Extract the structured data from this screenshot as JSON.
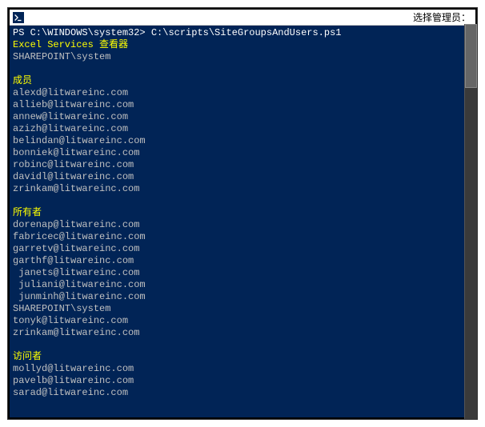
{
  "titlebar": {
    "icon_name": "powershell-icon",
    "title_text": "选择管理员："
  },
  "console": {
    "prompt_prefix": "PS C:\\WINDOWS\\system32>",
    "command": "C:\\scripts\\SiteGroupsAndUsers.ps1",
    "header_line1": "Excel Services 查看器",
    "header_line2": "SHAREPOINT\\system",
    "groups": [
      {
        "name": "成员",
        "members": [
          "alexd@litwareinc.com",
          "allieb@litwareinc.com",
          "annew@litwareinc.com",
          "azizh@litwareinc.com",
          "belindan@litwareinc.com",
          "bonniek@litwareinc.com",
          "robinc@litwareinc.com",
          "davidl@litwareinc.com",
          "zrinkam@litwareinc.com"
        ]
      },
      {
        "name": "所有者",
        "members": [
          "dorenap@litwareinc.com",
          "fabricec@litwareinc.com",
          "garretv@litwareinc.com",
          "garthf@litwareinc.com",
          " janets@litwareinc.com",
          " juliani@litwareinc.com",
          " junminh@litwareinc.com",
          "SHAREPOINT\\system",
          "tonyk@litwareinc.com",
          "zrinkam@litwareinc.com"
        ]
      },
      {
        "name": "访问者",
        "members": [
          "mollyd@litwareinc.com",
          "pavelb@litwareinc.com",
          "sarad@litwareinc.com"
        ]
      }
    ]
  }
}
